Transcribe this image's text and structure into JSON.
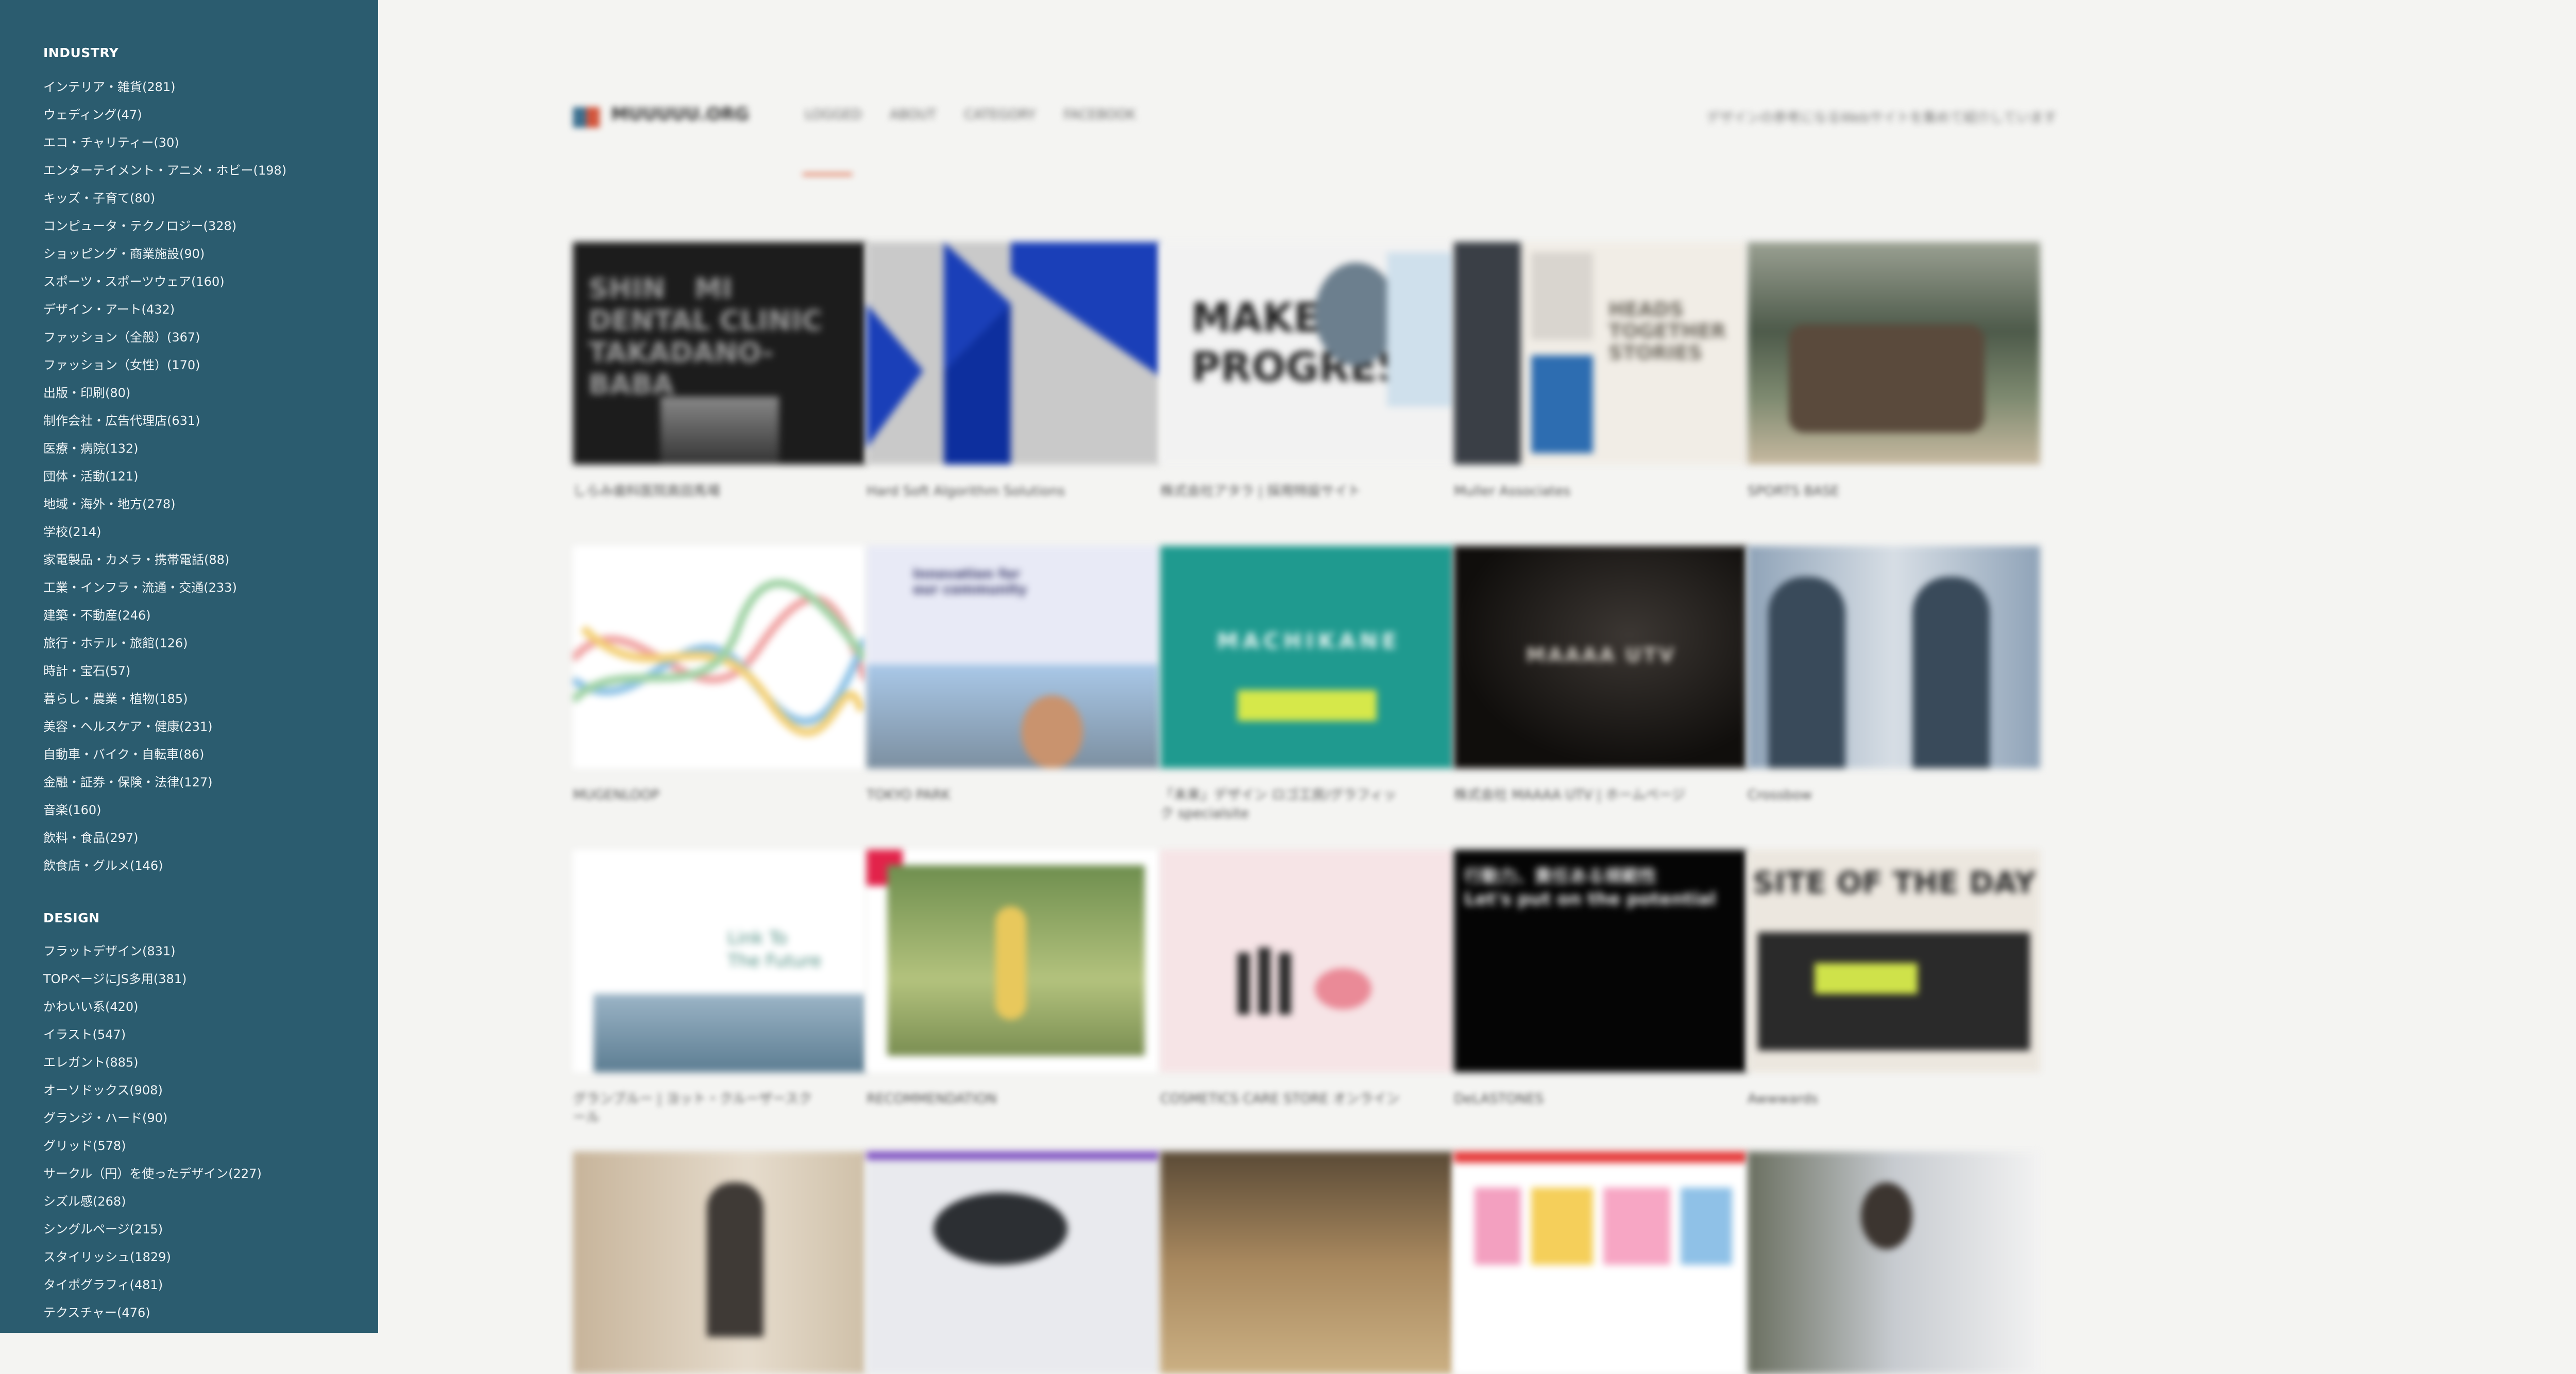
{
  "sidebar": {
    "industry_title": "INDUSTRY",
    "industry_items": [
      "インテリア・雑貨(281)",
      "ウェディング(47)",
      "エコ・チャリティー(30)",
      "エンターテイメント・アニメ・ホビー(198)",
      "キッズ・子育て(80)",
      "コンピュータ・テクノロジー(328)",
      "ショッピング・商業施設(90)",
      "スポーツ・スポーツウェア(160)",
      "デザイン・アート(432)",
      "ファッション（全般）(367)",
      "ファッション（女性）(170)",
      "出版・印刷(80)",
      "制作会社・広告代理店(631)",
      "医療・病院(132)",
      "団体・活動(121)",
      "地域・海外・地方(278)",
      "学校(214)",
      "家電製品・カメラ・携帯電話(88)",
      "工業・インフラ・流通・交通(233)",
      "建築・不動産(246)",
      "旅行・ホテル・旅館(126)",
      "時計・宝石(57)",
      "暮らし・農業・植物(185)",
      "美容・ヘルスケア・健康(231)",
      "自動車・バイク・自転車(86)",
      "金融・証券・保険・法律(127)",
      "音楽(160)",
      "飲料・食品(297)",
      "飲食店・グルメ(146)"
    ],
    "design_title": "DESIGN",
    "design_items": [
      "フラットデザイン(831)",
      "TOPページにJS多用(381)",
      "かわいい系(420)",
      "イラスト(547)",
      "エレガント(885)",
      "オーソドックス(908)",
      "グランジ・ハード(90)",
      "グリッド(578)",
      "サークル（円）を使ったデザイン(227)",
      "シズル感(268)",
      "シングルページ(215)",
      "スタイリッシュ(1829)",
      "タイポグラフィ(481)",
      "テクスチャー(476)"
    ]
  },
  "header": {
    "logo_text": "MUUUUU.ORG",
    "nav": [
      "LOGGED",
      "ABOUT",
      "CATEGORY",
      "FACEBOOK"
    ],
    "tagline": "デザインの参考になるWebサイトを集めて紹介しています"
  },
  "gallery": {
    "row1": [
      {
        "caption": "しらみ歯科医院高田馬場",
        "thumb_text": "SHIN   MI\nDENTAL CLINIC\nTAKADANO-\nBABA"
      },
      {
        "caption": "Hard Soft Algorithm Solutions",
        "thumb_text": ""
      },
      {
        "caption": "株式会社アタラ | 採用特設サイト",
        "thumb_text": "MAKE\nPROGRESS"
      },
      {
        "caption": "Muller Associates",
        "thumb_text": "HEADS\nTOGETHER\nSTORIES"
      },
      {
        "caption": "SPORTS BASE",
        "thumb_text": ""
      }
    ],
    "row2": [
      {
        "caption": "MUGENLOOP",
        "thumb_text": ""
      },
      {
        "caption": "TOKYO PARK",
        "thumb_text": "Innovation for\nour community"
      },
      {
        "caption": "「未来」デザイン ロゴ工房/グラフィック specialsite",
        "thumb_text": "MACHIKANE"
      },
      {
        "caption": "株式会社 MAAAA UTV | ホームページ",
        "thumb_text": "MAAAA UTV"
      },
      {
        "caption": "Crossbow",
        "thumb_text": ""
      }
    ],
    "row3": [
      {
        "caption": "グランブルー | ヨット・クルーザースクール",
        "thumb_text": "Link To\nThe Future"
      },
      {
        "caption": "RECOMMENDATION",
        "thumb_text": ""
      },
      {
        "caption": "COSMETICS CARE STORE オンライン",
        "thumb_text": ""
      },
      {
        "caption": "DeLASTONES",
        "thumb_text": "行動力、責任ある規範性\nLet's put on the potential"
      },
      {
        "caption": "Awwwards",
        "thumb_text": "SITE OF THE DAY"
      }
    ]
  },
  "colors": {
    "sidebar_bg": "#2b5c6f",
    "page_bg": "#f4f4f2",
    "accent": "#e06a4a"
  }
}
